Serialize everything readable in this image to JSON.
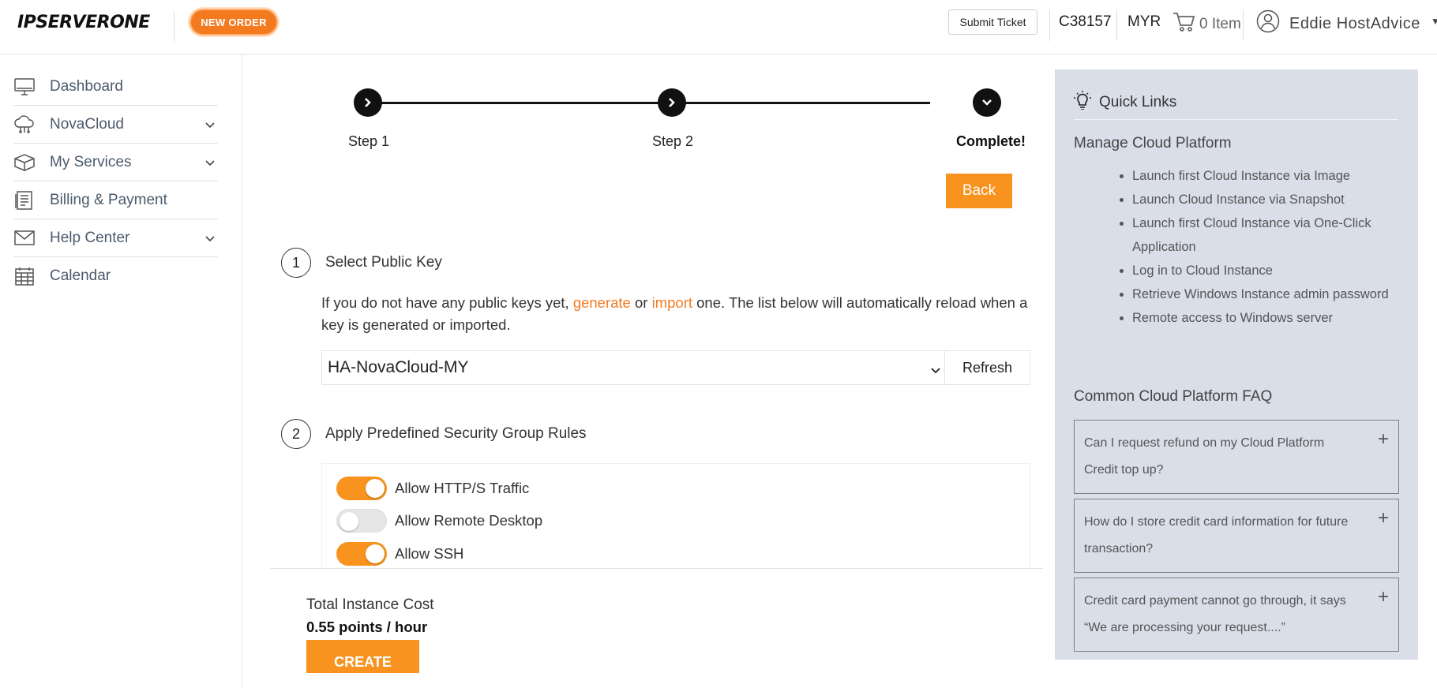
{
  "header": {
    "logo_text": "IPSERVERONE",
    "new_order_label": "NEW ORDER",
    "submit_ticket_label": "Submit Ticket",
    "account_id": "C38157",
    "currency": "MYR",
    "cart_label": "0 Item",
    "user_name": "Eddie HostAdvice"
  },
  "sidebar": {
    "items": [
      {
        "label": "Dashboard",
        "icon": "monitor-icon"
      },
      {
        "label": "NovaCloud",
        "icon": "cloud-icon"
      },
      {
        "label": "My Services",
        "icon": "box-icon"
      },
      {
        "label": "Billing & Payment",
        "icon": "receipt-icon"
      },
      {
        "label": "Help Center",
        "icon": "envelope-icon"
      },
      {
        "label": "Calendar",
        "icon": "calendar-icon"
      }
    ]
  },
  "stepper": {
    "steps": [
      {
        "label": "Step 1",
        "state": "done"
      },
      {
        "label": "Step 2",
        "state": "done"
      },
      {
        "label": "Complete!",
        "state": "current"
      }
    ],
    "back_label": "Back"
  },
  "section1": {
    "number": "1",
    "title": "Select Public Key",
    "text_before": "If you do not have any public keys yet, ",
    "link_generate": "generate",
    "text_or": " or ",
    "link_import": "import",
    "text_after": " one. The list below will automatically reload when a key is generated or imported.",
    "selected_key": "HA-NovaCloud-MY",
    "refresh_label": "Refresh"
  },
  "section2": {
    "number": "2",
    "title": "Apply Predefined Security Group Rules",
    "rules": [
      {
        "label": "Allow HTTP/S Traffic",
        "enabled": true
      },
      {
        "label": "Allow Remote Desktop",
        "enabled": false
      },
      {
        "label": "Allow SSH",
        "enabled": true
      }
    ]
  },
  "footer": {
    "cost_label": "Total Instance Cost",
    "cost_value": "0.55 points / hour",
    "create_label": "CREATE"
  },
  "quick_links": {
    "title": "Quick Links",
    "subtitle": "Manage Cloud Platform",
    "links": [
      "Launch first Cloud Instance via Image",
      "Launch Cloud Instance via Snapshot",
      "Launch first Cloud Instance via One-Click Application",
      "Log in to Cloud Instance",
      "Retrieve Windows Instance admin password",
      "Remote access to Windows server"
    ],
    "faq_title": "Common Cloud Platform FAQ",
    "faqs": [
      "Can I request refund on my Cloud Platform Credit top up?",
      "How do I store credit card information for future transaction?",
      "Credit card payment cannot go through, it says “We are processing your request....”"
    ]
  },
  "colors": {
    "accent": "#f7931e",
    "link": "#f47a20",
    "panel_bg": "#d9dee9"
  }
}
